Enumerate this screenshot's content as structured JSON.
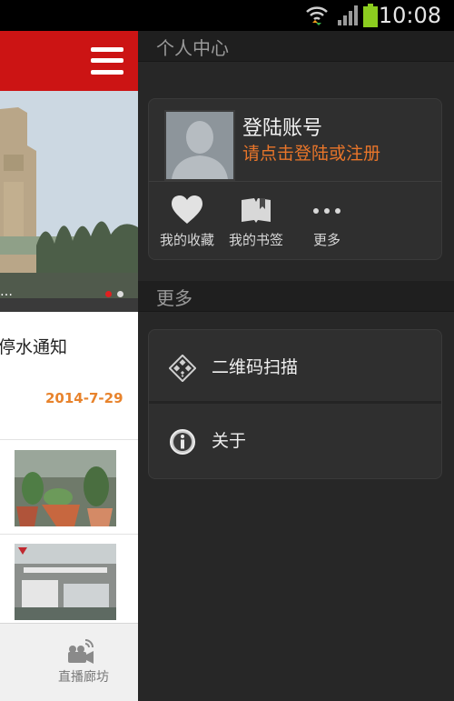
{
  "status_bar": {
    "time": "10:08"
  },
  "app_behind": {
    "notice_title": "停水通知",
    "notice_date": "2014-7-29",
    "banner_dots_text": "…",
    "bottom_nav_label": "直播廊坊"
  },
  "drawer": {
    "personal_center_header": "个人中心",
    "account": {
      "title": "登陆账号",
      "subtitle": "请点击登陆或注册"
    },
    "actions": [
      {
        "label": "我的收藏",
        "icon": "heart-icon"
      },
      {
        "label": "我的书签",
        "icon": "bookmark-icon"
      },
      {
        "label": "更多",
        "icon": "more-dots-icon"
      }
    ],
    "more_header": "更多",
    "menu_items": [
      {
        "label": "二维码扫描",
        "icon": "qr-code-icon"
      },
      {
        "label": "关于",
        "icon": "info-icon"
      }
    ]
  },
  "colors": {
    "app_red": "#cc1414",
    "accent_orange": "#e8752a",
    "drawer_bg": "#272727"
  }
}
